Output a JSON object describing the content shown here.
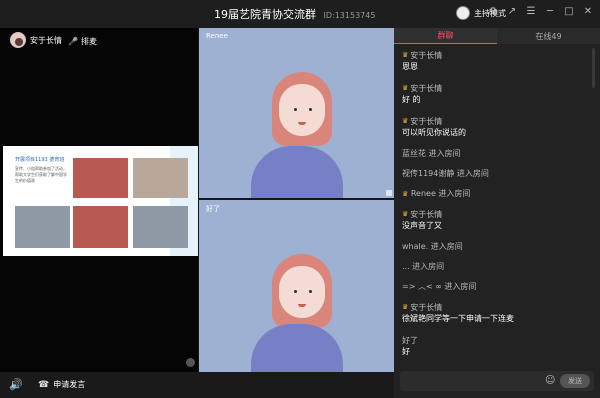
{
  "titlebar": {
    "title": "19届艺院青协交流群",
    "room_id": "ID:13153745",
    "host_mode": "主持模式",
    "icons": [
      "settings-icon",
      "share-icon",
      "menu-icon",
      "minimize-icon",
      "maximize-icon",
      "close-icon"
    ]
  },
  "left_panel": {
    "user_name": "安于长情",
    "mic_label": "排麦",
    "slide": {
      "title": "开展项目1193 德育班",
      "text": "宣传、小组帮助参加了活动，帮助大学生们获取了解中国学生的价值观"
    }
  },
  "videos": [
    {
      "label": "Renee"
    },
    {
      "label": "好了"
    }
  ],
  "bottom": {
    "apply_label": "申请发言"
  },
  "chat": {
    "tabs": [
      {
        "label": "群聊",
        "active": true
      },
      {
        "label": "在线49",
        "active": false
      }
    ],
    "messages": [
      {
        "sender": "安于长情",
        "text": "恩恩"
      },
      {
        "sender": "安于长情",
        "text": "好 的"
      },
      {
        "sender": "安于长情",
        "text": "可以听见你说话的"
      },
      {
        "system": "蓝丝花 进入房间"
      },
      {
        "system": "视传1194谢静 进入房间"
      },
      {
        "system": "Renee 进入房间",
        "crown": true
      },
      {
        "sender": "安于长情",
        "text": "没声音了又"
      },
      {
        "system": "whale. 进入房间"
      },
      {
        "system": "... 进入房间"
      },
      {
        "system": "=>  ︿<  ∞ 进入房间"
      },
      {
        "sender": "安于长情",
        "text": "徐斌艳同学等一下申请一下连麦"
      },
      {
        "sender": "好了",
        "text": "好"
      }
    ],
    "send_label": "发送"
  }
}
